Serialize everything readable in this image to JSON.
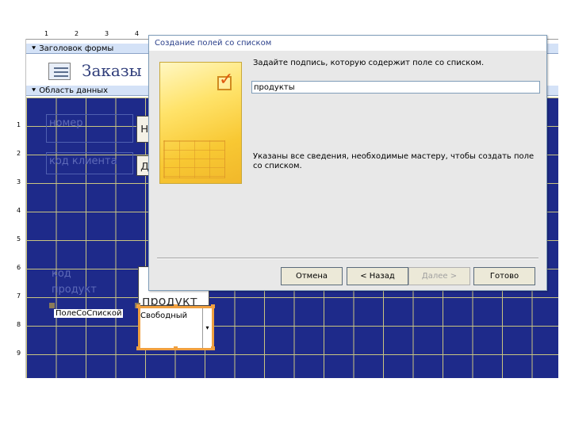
{
  "rulers": {
    "top_ticks": [
      "1",
      "2",
      "3",
      "4"
    ],
    "left_ticks": [
      "1",
      "2",
      "3",
      "4",
      "5",
      "6",
      "7",
      "8",
      "9"
    ]
  },
  "form": {
    "header_section": "Заголовок формы",
    "form_title": "Заказы",
    "detail_section": "Область данных",
    "labels": [
      "номер",
      "код клиента",
      "код продукт"
    ],
    "field_fragments": [
      "н",
      "д",
      "продукт"
    ],
    "combo_name": "ПолеСоСпиской",
    "combo_value": "Свободный"
  },
  "dialog": {
    "title": "Создание полей со списком",
    "prompt": "Задайте подпись, которую содержит поле со списком.",
    "caption_value": "продукты",
    "info": "Указаны все сведения, необходимые мастеру, чтобы создать поле со списком.",
    "buttons": {
      "cancel": "Отмена",
      "back": "< Назад",
      "next": "Далее >",
      "finish": "Готово"
    }
  },
  "colors": {
    "detail_background": "#1e2a8a",
    "grid_lines": "#c9c480",
    "selection": "#f0a040",
    "dialog_title_text": "#2a3f8a"
  },
  "icons": [
    "form-icon",
    "check-icon",
    "dropdown-arrow-icon",
    "section-arrow-icon"
  ]
}
